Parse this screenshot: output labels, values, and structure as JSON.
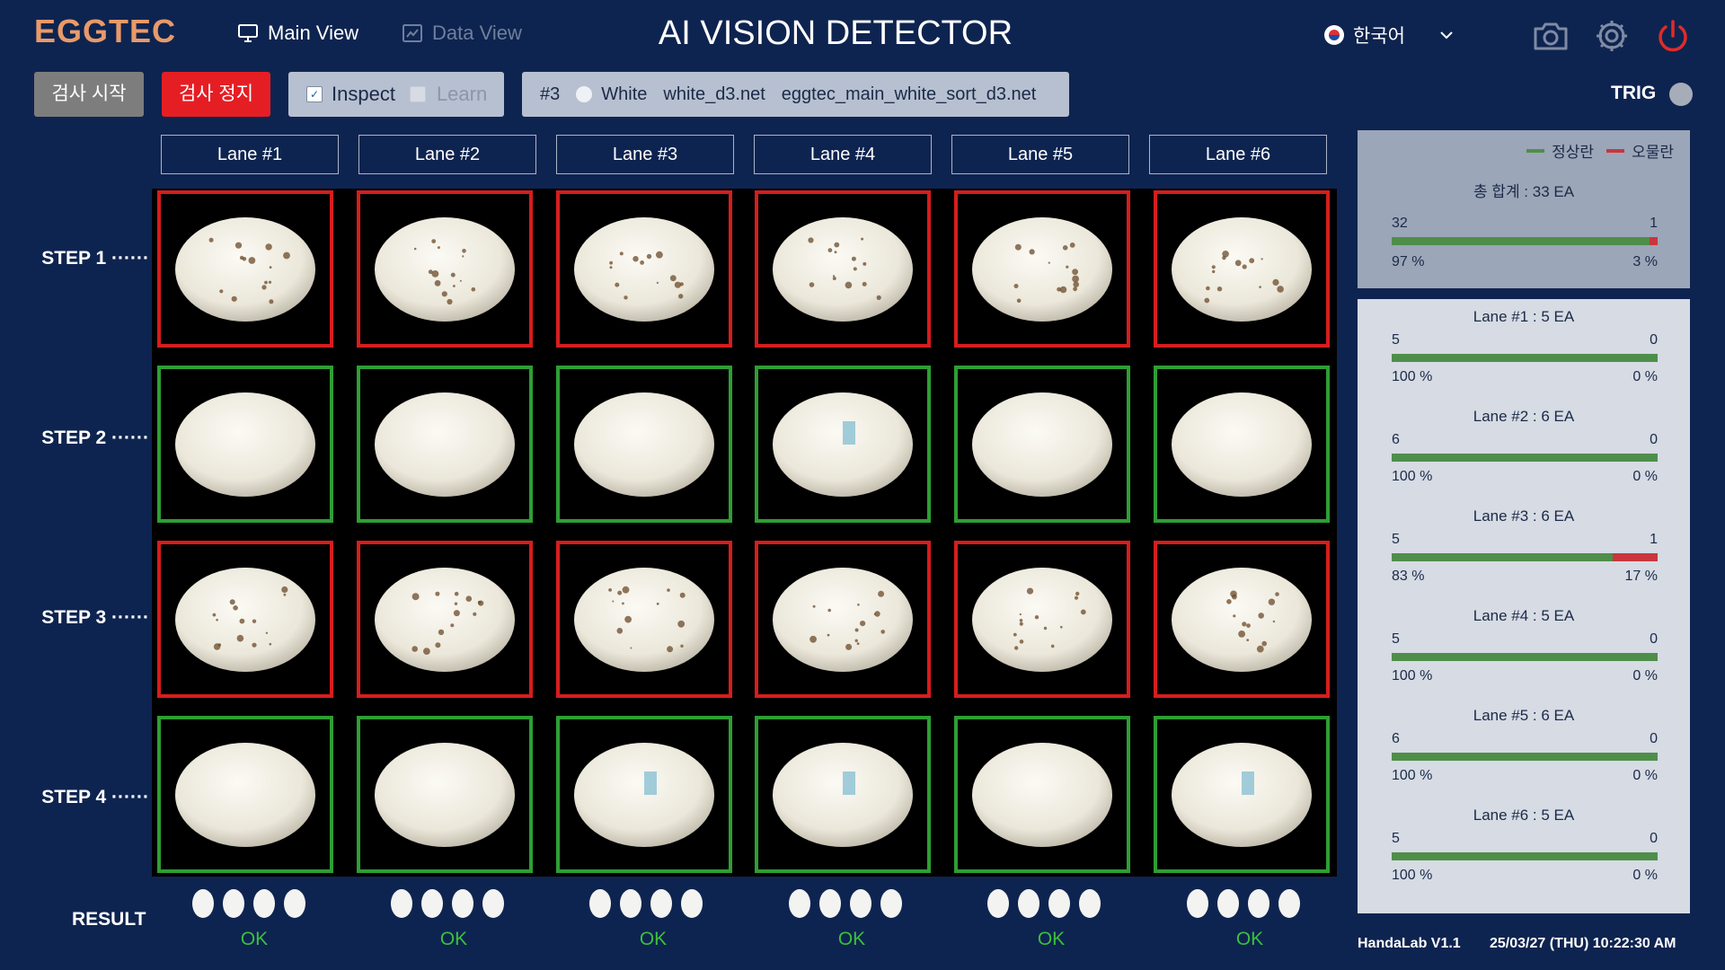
{
  "header": {
    "logo": "EGGTEC",
    "nav_main": "Main View",
    "nav_data": "Data View",
    "title": "AI VISION DETECTOR",
    "language": "한국어"
  },
  "toolbar": {
    "start_label": "검사 시작",
    "stop_label": "검사 정지",
    "inspect_label": "Inspect",
    "learn_label": "Learn",
    "model_index": "#3",
    "egg_color": "White",
    "model_file": "white_d3.net",
    "sort_file": "eggtec_main_white_sort_d3.net",
    "trig_label": "TRIG"
  },
  "lanes": [
    "Lane #1",
    "Lane #2",
    "Lane #3",
    "Lane #4",
    "Lane #5",
    "Lane #6"
  ],
  "steps": [
    "STEP 1 ······",
    "STEP 2 ······",
    "STEP 3 ······",
    "STEP 4 ······"
  ],
  "grid_status": [
    [
      "ng",
      "ng",
      "ng",
      "ng",
      "ng",
      "ng"
    ],
    [
      "ok",
      "ok",
      "ok",
      "ok",
      "ok",
      "ok"
    ],
    [
      "ng",
      "ng",
      "ng",
      "ng",
      "ng",
      "ng"
    ],
    [
      "ok",
      "ok",
      "ok",
      "ok",
      "ok",
      "ok"
    ]
  ],
  "result": {
    "label": "RESULT",
    "lane_results": [
      "OK",
      "OK",
      "OK",
      "OK",
      "OK",
      "OK"
    ]
  },
  "colors": {
    "ng_border": "#d61d1d",
    "ok_border": "#2e9e34",
    "normal_bar": "#4f8e4a",
    "dirty_bar": "#c9363d",
    "ok_text": "#3cbf3e"
  },
  "summary": {
    "legend_normal": "정상란",
    "legend_dirty": "오물란",
    "total_title": "총 합계 : 33 EA",
    "normal_count": "32",
    "dirty_count": "1",
    "normal_pct": "97 %",
    "dirty_pct": "3 %",
    "normal_fraction": 0.97
  },
  "lane_stats": [
    {
      "title": "Lane #1 : 5 EA",
      "normal": "5",
      "dirty": "0",
      "normal_pct": "100 %",
      "dirty_pct": "0 %",
      "fraction": 1.0
    },
    {
      "title": "Lane #2 : 6 EA",
      "normal": "6",
      "dirty": "0",
      "normal_pct": "100 %",
      "dirty_pct": "0 %",
      "fraction": 1.0
    },
    {
      "title": "Lane #3 : 6 EA",
      "normal": "5",
      "dirty": "1",
      "normal_pct": "83 %",
      "dirty_pct": "17 %",
      "fraction": 0.83
    },
    {
      "title": "Lane #4 : 5 EA",
      "normal": "5",
      "dirty": "0",
      "normal_pct": "100 %",
      "dirty_pct": "0 %",
      "fraction": 1.0
    },
    {
      "title": "Lane #5 : 6 EA",
      "normal": "6",
      "dirty": "0",
      "normal_pct": "100 %",
      "dirty_pct": "0 %",
      "fraction": 1.0
    },
    {
      "title": "Lane #6 : 5 EA",
      "normal": "5",
      "dirty": "0",
      "normal_pct": "100 %",
      "dirty_pct": "0 %",
      "fraction": 1.0
    }
  ],
  "footer": {
    "version": "HandaLab V1.1",
    "datetime": "25/03/27 (THU) 10:22:30 AM"
  }
}
